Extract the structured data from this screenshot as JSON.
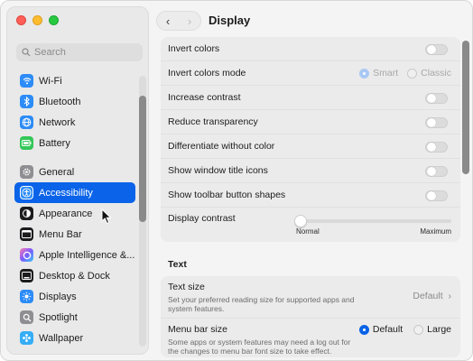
{
  "window": {
    "title": "Display"
  },
  "sidebar": {
    "search_placeholder": "Search",
    "items": [
      {
        "label": "Wi‑Fi",
        "icon": "wifi-icon"
      },
      {
        "label": "Bluetooth",
        "icon": "bluetooth-icon"
      },
      {
        "label": "Network",
        "icon": "network-icon"
      },
      {
        "label": "Battery",
        "icon": "battery-icon"
      },
      {
        "label": "General",
        "icon": "gear-icon"
      },
      {
        "label": "Accessibility",
        "icon": "accessibility-icon",
        "selected": true
      },
      {
        "label": "Appearance",
        "icon": "appearance-icon"
      },
      {
        "label": "Menu Bar",
        "icon": "menu-bar-icon"
      },
      {
        "label": "Apple Intelligence &...",
        "icon": "apple-intelligence-icon"
      },
      {
        "label": "Desktop & Dock",
        "icon": "desktop-dock-icon"
      },
      {
        "label": "Displays",
        "icon": "displays-icon"
      },
      {
        "label": "Spotlight",
        "icon": "spotlight-icon"
      },
      {
        "label": "Wallpaper",
        "icon": "wallpaper-icon"
      }
    ]
  },
  "display_panel": {
    "rows": [
      {
        "label": "Invert colors",
        "control": "toggle",
        "value": false
      },
      {
        "label": "Invert colors mode",
        "control": "radio",
        "options": [
          "Smart",
          "Classic"
        ],
        "selected": "Smart",
        "disabled": true
      },
      {
        "label": "Increase contrast",
        "control": "toggle",
        "value": false
      },
      {
        "label": "Reduce transparency",
        "control": "toggle",
        "value": false
      },
      {
        "label": "Differentiate without color",
        "control": "toggle",
        "value": false
      },
      {
        "label": "Show window title icons",
        "control": "toggle",
        "value": false
      },
      {
        "label": "Show toolbar button shapes",
        "control": "toggle",
        "value": false
      }
    ],
    "display_contrast": {
      "label": "Display contrast",
      "min_label": "Normal",
      "max_label": "Maximum",
      "value": 0
    }
  },
  "text_section": {
    "heading": "Text",
    "text_size": {
      "title": "Text size",
      "subtitle": "Set your preferred reading size for supported apps and system features.",
      "value": "Default"
    },
    "menu_bar_size": {
      "title": "Menu bar size",
      "subtitle": "Some apps or system features may need a log out for the changes to menu bar font size to take effect.",
      "options": [
        "Default",
        "Large"
      ],
      "selected": "Default"
    }
  },
  "colors": {
    "accent": "#0a63e8",
    "sidebar_bg": "#e9e9e9",
    "panel_bg": "#ebebeb"
  }
}
